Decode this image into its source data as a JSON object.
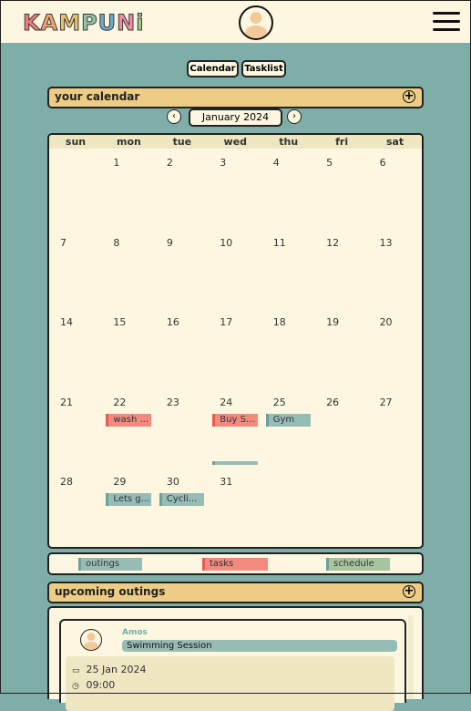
{
  "header": {
    "logo": [
      "K",
      "A",
      "M",
      "P",
      "U",
      "N",
      "i"
    ],
    "logo_colors": [
      "#f27d73",
      "#f5a46e",
      "#e9c36b",
      "#8fc6a8",
      "#6fa9c9",
      "#f28aa4",
      "#9bcf88"
    ]
  },
  "views": {
    "calendar": "Calendar",
    "tasklist": "Tasklist"
  },
  "calendar": {
    "title": "your calendar",
    "add": "+",
    "month": "January 2024",
    "prev": "‹",
    "next": "›",
    "days": [
      "sun",
      "mon",
      "tue",
      "wed",
      "thu",
      "fri",
      "sat"
    ],
    "weeks": [
      [
        "",
        "1",
        "2",
        "3",
        "4",
        "5",
        "6"
      ],
      [
        "7",
        "8",
        "9",
        "10",
        "11",
        "12",
        "13"
      ],
      [
        "14",
        "15",
        "16",
        "17",
        "18",
        "19",
        "20"
      ],
      [
        "21",
        "22",
        "23",
        "24",
        "25",
        "26",
        "27"
      ],
      [
        "28",
        "29",
        "30",
        "31",
        "",
        "",
        ""
      ]
    ],
    "events": [
      {
        "week": 3,
        "day": 1,
        "label": "wash ...",
        "kind": "task"
      },
      {
        "week": 3,
        "day": 3,
        "label": "Buy S...",
        "kind": "task"
      },
      {
        "week": 3,
        "day": 4,
        "label": "Gym",
        "kind": "outing"
      },
      {
        "week": 3,
        "day": 3,
        "label": "",
        "kind": "outing",
        "row": 2
      },
      {
        "week": 4,
        "day": 1,
        "label": "Lets g...",
        "kind": "outing"
      },
      {
        "week": 4,
        "day": 2,
        "label": "Cycli...",
        "kind": "outing"
      }
    ]
  },
  "legend": {
    "outings": "outings",
    "tasks": "tasks",
    "schedule": "schedule"
  },
  "upcoming": {
    "title": "upcoming outings",
    "add": "+",
    "card": {
      "user": "Amos",
      "title": "Swimming Session",
      "date": "25 Jan 2024",
      "time": "09:00"
    }
  }
}
